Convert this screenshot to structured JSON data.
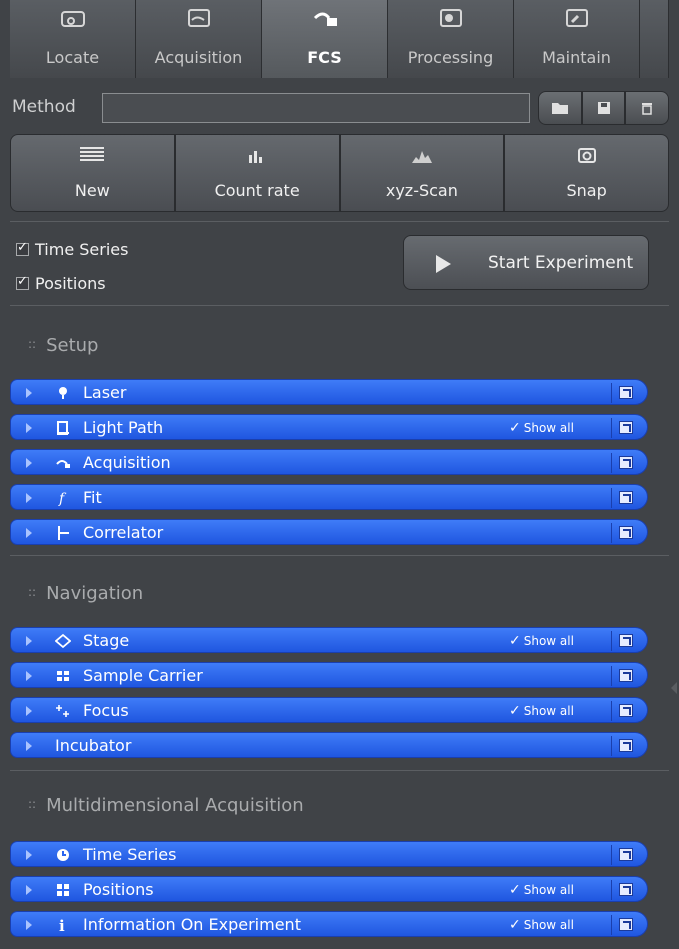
{
  "tabs": [
    {
      "label": "Locate",
      "icon": "locate-icon",
      "active": false
    },
    {
      "label": "Acquisition",
      "icon": "acquisition-icon",
      "active": false
    },
    {
      "label": "FCS",
      "icon": "fcs-icon",
      "active": true
    },
    {
      "label": "Processing",
      "icon": "processing-icon",
      "active": false
    },
    {
      "label": "Maintain",
      "icon": "maintain-icon",
      "active": false
    }
  ],
  "method": {
    "label": "Method",
    "value": "",
    "buttons": [
      "open-folder-icon",
      "save-icon",
      "delete-icon"
    ]
  },
  "tools": [
    {
      "label": "New",
      "icon": "new-icon"
    },
    {
      "label": "Count rate",
      "icon": "count-rate-icon"
    },
    {
      "label": "xyz-Scan",
      "icon": "xyz-scan-icon"
    },
    {
      "label": "Snap",
      "icon": "snap-icon"
    }
  ],
  "options": {
    "time_series": {
      "label": "Time Series",
      "checked": true
    },
    "positions": {
      "label": "Positions",
      "checked": true
    }
  },
  "start": {
    "label": "Start Experiment"
  },
  "sections": {
    "setup": {
      "title": "Setup",
      "rows": [
        {
          "label": "Laser",
          "icon": "laser-icon",
          "show_all": ""
        },
        {
          "label": "Light Path",
          "icon": "light-path-icon",
          "show_all": "Show all"
        },
        {
          "label": "Acquisition",
          "icon": "acquisition-row-icon",
          "show_all": ""
        },
        {
          "label": "Fit",
          "icon": "fit-icon",
          "show_all": ""
        },
        {
          "label": "Correlator",
          "icon": "correlator-icon",
          "show_all": ""
        }
      ]
    },
    "navigation": {
      "title": "Navigation",
      "rows": [
        {
          "label": "Stage",
          "icon": "stage-icon",
          "show_all": "Show all"
        },
        {
          "label": "Sample Carrier",
          "icon": "sample-carrier-icon",
          "show_all": ""
        },
        {
          "label": "Focus",
          "icon": "focus-icon",
          "show_all": "Show all"
        },
        {
          "label": "Incubator",
          "icon": "",
          "show_all": ""
        }
      ]
    },
    "multidim": {
      "title": "Multidimensional Acquisition",
      "rows": [
        {
          "label": "Time Series",
          "icon": "time-series-icon",
          "show_all": ""
        },
        {
          "label": "Positions",
          "icon": "positions-icon",
          "show_all": "Show all"
        },
        {
          "label": "Information On Experiment",
          "icon": "info-icon",
          "show_all": "Show all"
        }
      ]
    }
  },
  "colors": {
    "background": "#404347",
    "row_blue": "#2b66f0",
    "tab_active": "#6f7378"
  }
}
